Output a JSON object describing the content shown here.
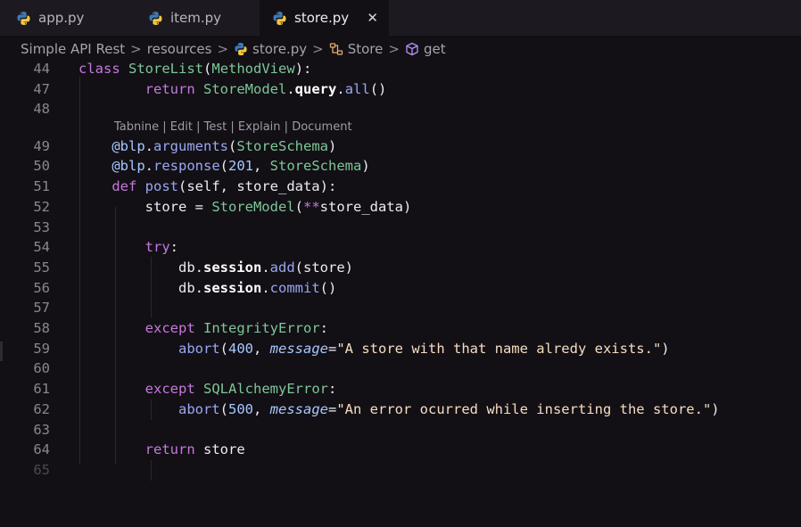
{
  "tabs": [
    {
      "label": "app.py",
      "active": false
    },
    {
      "label": "item.py",
      "active": false
    },
    {
      "label": "store.py",
      "active": true,
      "close": "✕"
    }
  ],
  "breadcrumb": {
    "items": [
      "Simple API Rest",
      "resources",
      "store.py",
      "Store",
      "get"
    ],
    "separator": ">"
  },
  "codelens": [
    "Tabnine",
    "Edit",
    "Test",
    "Explain",
    "Document"
  ],
  "codelens_separator": "|",
  "lines": [
    {
      "n": "44",
      "tokens": [
        [
          "kw",
          "class"
        ],
        [
          "t",
          " "
        ],
        [
          "cls",
          "StoreList"
        ],
        [
          "t",
          "("
        ],
        [
          "cls",
          "MethodView"
        ],
        [
          "t",
          "):"
        ]
      ]
    },
    {
      "n": "47",
      "tokens": [
        [
          "t",
          "        "
        ],
        [
          "kw",
          "return"
        ],
        [
          "t",
          " "
        ],
        [
          "cls",
          "StoreModel"
        ],
        [
          "t",
          "."
        ],
        [
          "bold",
          "query"
        ],
        [
          "t",
          "."
        ],
        [
          "fn",
          "all"
        ],
        [
          "t",
          "()"
        ]
      ]
    },
    {
      "n": "48",
      "tokens": []
    },
    {
      "n": "49",
      "tokens": [
        [
          "t",
          "    "
        ],
        [
          "dec",
          "@blp"
        ],
        [
          "t",
          "."
        ],
        [
          "fn",
          "arguments"
        ],
        [
          "t",
          "("
        ],
        [
          "cls",
          "StoreSchema"
        ],
        [
          "t",
          ")"
        ]
      ]
    },
    {
      "n": "50",
      "tokens": [
        [
          "t",
          "    "
        ],
        [
          "dec",
          "@blp"
        ],
        [
          "t",
          "."
        ],
        [
          "fn",
          "response"
        ],
        [
          "t",
          "("
        ],
        [
          "num",
          "201"
        ],
        [
          "t",
          ", "
        ],
        [
          "cls",
          "StoreSchema"
        ],
        [
          "t",
          ")"
        ]
      ]
    },
    {
      "n": "51",
      "tokens": [
        [
          "t",
          "    "
        ],
        [
          "kw",
          "def"
        ],
        [
          "t",
          " "
        ],
        [
          "fn",
          "post"
        ],
        [
          "t",
          "(self, store_data):"
        ]
      ]
    },
    {
      "n": "52",
      "tokens": [
        [
          "t",
          "        store = "
        ],
        [
          "cls",
          "StoreModel"
        ],
        [
          "t",
          "("
        ],
        [
          "kw",
          "**"
        ],
        [
          "t",
          "store_data)"
        ]
      ]
    },
    {
      "n": "53",
      "tokens": []
    },
    {
      "n": "54",
      "tokens": [
        [
          "t",
          "        "
        ],
        [
          "kw",
          "try"
        ],
        [
          "t",
          ":"
        ]
      ]
    },
    {
      "n": "55",
      "tokens": [
        [
          "t",
          "            db."
        ],
        [
          "bold",
          "session"
        ],
        [
          "t",
          "."
        ],
        [
          "fn",
          "add"
        ],
        [
          "t",
          "(store)"
        ]
      ]
    },
    {
      "n": "56",
      "tokens": [
        [
          "t",
          "            db."
        ],
        [
          "bold",
          "session"
        ],
        [
          "t",
          "."
        ],
        [
          "fn",
          "commit"
        ],
        [
          "t",
          "()"
        ]
      ]
    },
    {
      "n": "57",
      "tokens": []
    },
    {
      "n": "58",
      "tokens": [
        [
          "t",
          "        "
        ],
        [
          "kw",
          "except"
        ],
        [
          "t",
          " "
        ],
        [
          "cls",
          "IntegrityError"
        ],
        [
          "t",
          ":"
        ]
      ]
    },
    {
      "n": "59",
      "tokens": [
        [
          "t",
          "            "
        ],
        [
          "fn",
          "abort"
        ],
        [
          "t",
          "("
        ],
        [
          "num",
          "400"
        ],
        [
          "t",
          ", "
        ],
        [
          "param",
          "message"
        ],
        [
          "t",
          "="
        ],
        [
          "str",
          "\"A store with that name alredy exists.\""
        ],
        [
          "t",
          ")"
        ]
      ]
    },
    {
      "n": "60",
      "tokens": []
    },
    {
      "n": "61",
      "tokens": [
        [
          "t",
          "        "
        ],
        [
          "kw",
          "except"
        ],
        [
          "t",
          " "
        ],
        [
          "cls",
          "SQLAlchemyError"
        ],
        [
          "t",
          ":"
        ]
      ]
    },
    {
      "n": "62",
      "tokens": [
        [
          "t",
          "            "
        ],
        [
          "fn",
          "abort"
        ],
        [
          "t",
          "("
        ],
        [
          "num",
          "500"
        ],
        [
          "t",
          ", "
        ],
        [
          "param",
          "message"
        ],
        [
          "t",
          "="
        ],
        [
          "str",
          "\"An error ocurred while inserting the store.\""
        ],
        [
          "t",
          ")"
        ]
      ]
    },
    {
      "n": "63",
      "tokens": []
    },
    {
      "n": "64",
      "tokens": [
        [
          "t",
          "        "
        ],
        [
          "kw",
          "return"
        ],
        [
          "t",
          " store"
        ]
      ]
    },
    {
      "n": "65",
      "tokens": [],
      "dim": true
    }
  ],
  "colors": {
    "background": "#121015",
    "keyword": "#c678dd",
    "class": "#7ec699",
    "function": "#9aa7f2",
    "string": "#f6dcc0",
    "number": "#a7c8ff"
  },
  "icons": {
    "tab": "python-icon",
    "breadcrumb_class": "class-symbol-icon",
    "breadcrumb_method": "method-cube-icon"
  }
}
